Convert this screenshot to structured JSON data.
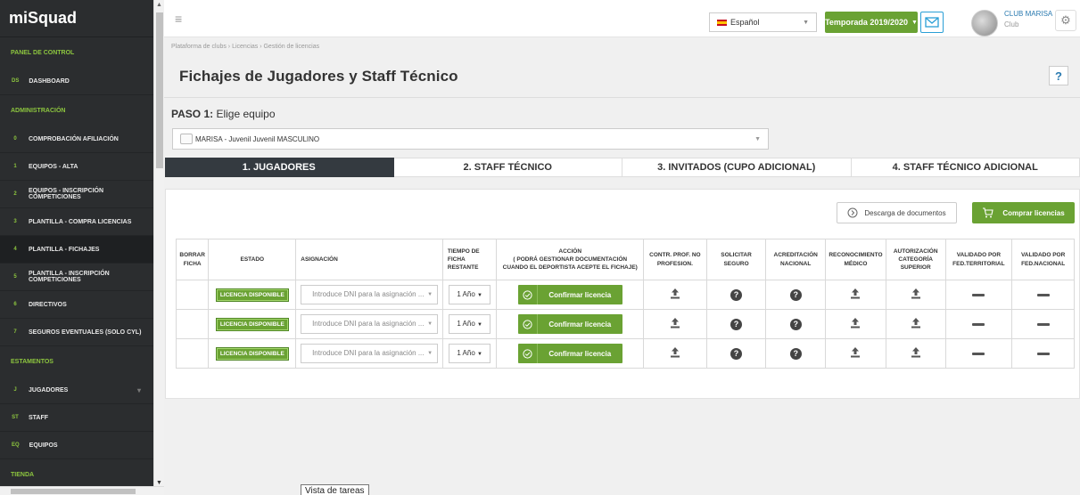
{
  "brand": "miSquad",
  "sidebar": {
    "sections": [
      {
        "label": "PANEL DE CONTROL",
        "items": [
          {
            "badge": "Ds",
            "label": "DASHBOARD"
          }
        ]
      },
      {
        "label": "ADMINISTRACIÓN",
        "items": [
          {
            "badge": "0",
            "label": "COMPROBACIÓN AFILIACIÓN"
          },
          {
            "badge": "1",
            "label": "EQUIPOS - ALTA"
          },
          {
            "badge": "2",
            "label": "EQUIPOS - INSCRIPCIÓN COMPETICIONES"
          },
          {
            "badge": "3",
            "label": "PLANTILLA - COMPRA LICENCIAS"
          },
          {
            "badge": "4",
            "label": "PLANTILLA - FICHAJES"
          },
          {
            "badge": "5",
            "label": "PLANTILLA - INSCRIPCIÓN COMPETICIONES"
          },
          {
            "badge": "6",
            "label": "DIRECTIVOS"
          },
          {
            "badge": "7",
            "label": "SEGUROS EVENTUALES (SOLO CYL)"
          }
        ]
      },
      {
        "label": "ESTAMENTOS",
        "items": [
          {
            "badge": "J",
            "label": "JUGADORES"
          },
          {
            "badge": "St",
            "label": "STAFF"
          },
          {
            "badge": "Eq",
            "label": "EQUIPOS"
          }
        ]
      },
      {
        "label": "TIENDA",
        "items": []
      }
    ]
  },
  "topbar": {
    "language": "Español",
    "season": "Temporada 2019/2020",
    "club_name": "CLUB MARISA",
    "club_role": "Club"
  },
  "breadcrumb": "Plataforma de clubs  ›  Licencias  ›  Gestión de licencias",
  "page_title": "Fichajes de Jugadores y Staff Técnico",
  "help_label": "?",
  "step": {
    "prefix": "PASO 1:",
    "text": " Elige equipo"
  },
  "team_select": "MARISA - Juvenil Juvenil MASCULINO",
  "tabs": [
    "1. JUGADORES",
    "2. STAFF TÉCNICO",
    "3. INVITADOS (CUPO ADICIONAL)",
    "4. STAFF TÉCNICO ADICIONAL"
  ],
  "actions": {
    "download_docs": "Descarga de documentos",
    "buy_licenses": "Comprar licencias"
  },
  "table": {
    "headers": {
      "delete": "BORRAR FICHA",
      "status": "ESTADO",
      "assignment": "ASIGNACIÓN",
      "remaining": "TIEMPO DE FICHA RESTANTE",
      "action_title": "ACCIÓN",
      "action_note": "( PODRÁ GESTIONAR DOCUMENTACIÓN CUANDO EL DEPORTISTA ACEPTE EL FICHAJE)",
      "contract": "CONTR. PROF. NO PROFESION.",
      "insurance": "SOLICITAR SEGURO",
      "accreditation": "ACREDITACIÓN NACIONAL",
      "medical": "RECONOCIMIENTO MÉDICO",
      "authorization": "AUTORIZACIÓN CATEGORÍA SUPERIOR",
      "validated_territorial": "VALIDADO POR FED.TERRITORIAL",
      "validated_national": "VALIDADO POR FED.NACIONAL"
    },
    "rows": [
      {
        "status": "LICENCIA DISPONIBLE",
        "dni_placeholder": "Introduce DNI para la asignación ...",
        "duration": "1 Año",
        "confirm": "Confirmar licencia"
      },
      {
        "status": "LICENCIA DISPONIBLE",
        "dni_placeholder": "Introduce DNI para la asignación ...",
        "duration": "1 Año",
        "confirm": "Confirmar licencia"
      },
      {
        "status": "LICENCIA DISPONIBLE",
        "dni_placeholder": "Introduce DNI para la asignación ...",
        "duration": "1 Año",
        "confirm": "Confirmar licencia"
      }
    ]
  },
  "tooltip": "Vista de tareas",
  "colors": {
    "accent_green": "#6aa233",
    "sidebar_bg": "#2b2d2f",
    "tab_active": "#343a40",
    "link_blue": "#2a7ab0"
  }
}
